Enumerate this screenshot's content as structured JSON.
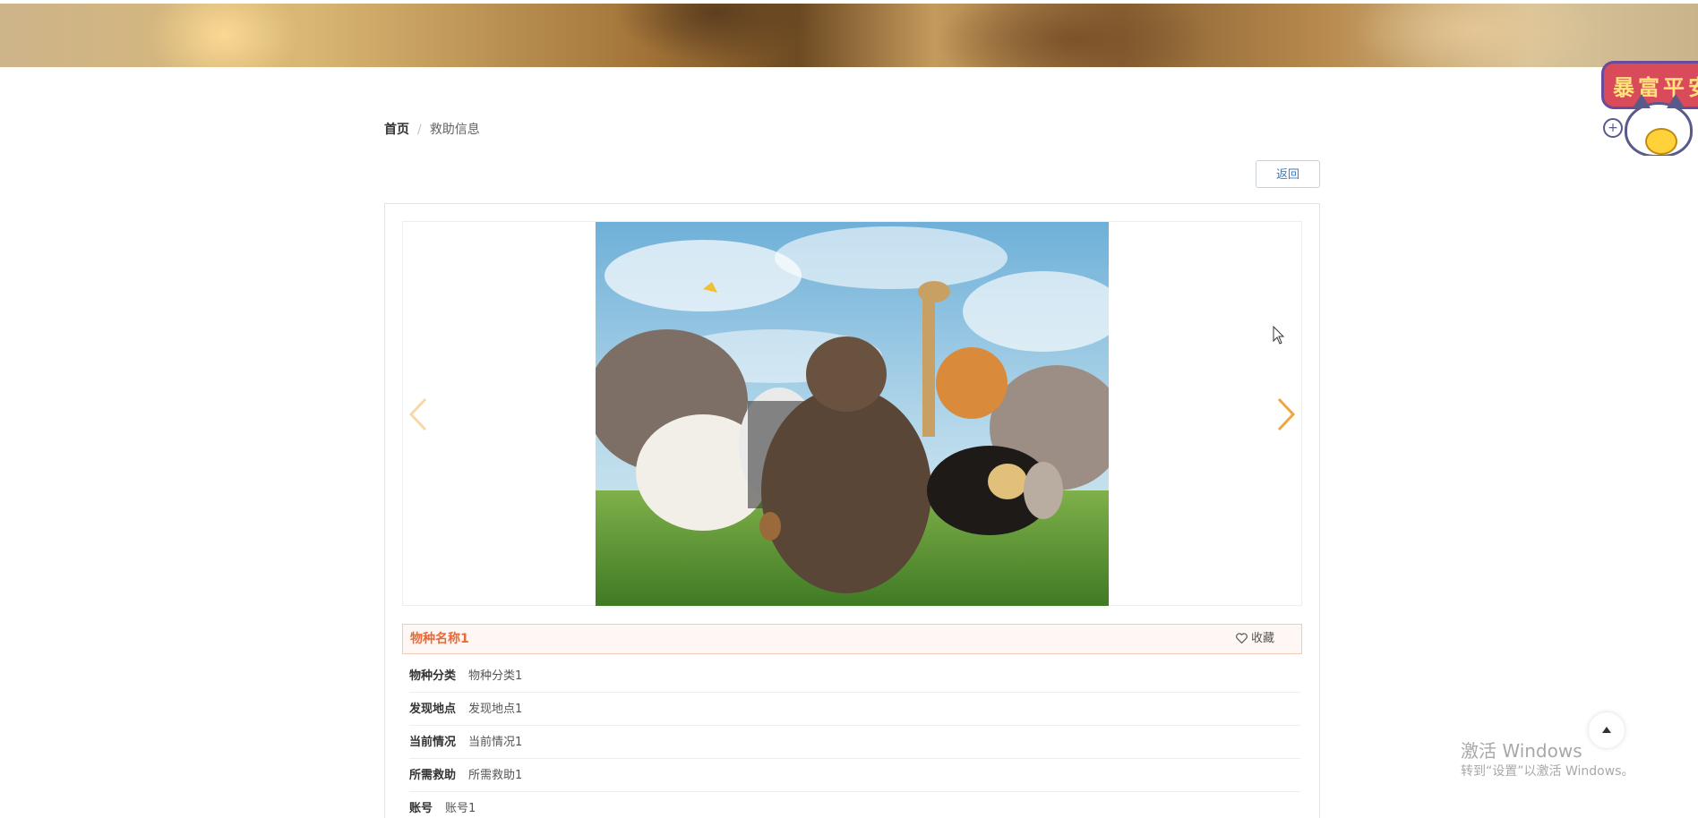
{
  "mascot": {
    "sign_text": "暴富平安"
  },
  "breadcrumb": {
    "home": "首页",
    "separator": "/",
    "current": "救助信息"
  },
  "toolbar": {
    "back_label": "返回"
  },
  "detail": {
    "title": "物种名称1",
    "favorite_label": "收藏",
    "fields": [
      {
        "label": "物种分类",
        "value": "物种分类1"
      },
      {
        "label": "发现地点",
        "value": "发现地点1"
      },
      {
        "label": "当前情况",
        "value": "当前情况1"
      },
      {
        "label": "所需救助",
        "value": "所需救助1"
      },
      {
        "label": "账号",
        "value": "账号1"
      }
    ]
  },
  "watermark": {
    "title": "激活 Windows",
    "subtitle": "转到“设置”以激活 Windows。"
  },
  "colors": {
    "accent": "#e86a3a",
    "arrow": "#f0a640",
    "link": "#3b7bbf"
  },
  "icons": {
    "prev": "chevron-left-icon",
    "next": "chevron-right-icon",
    "favorite": "heart-outline-icon",
    "back_top": "caret-up-icon"
  }
}
